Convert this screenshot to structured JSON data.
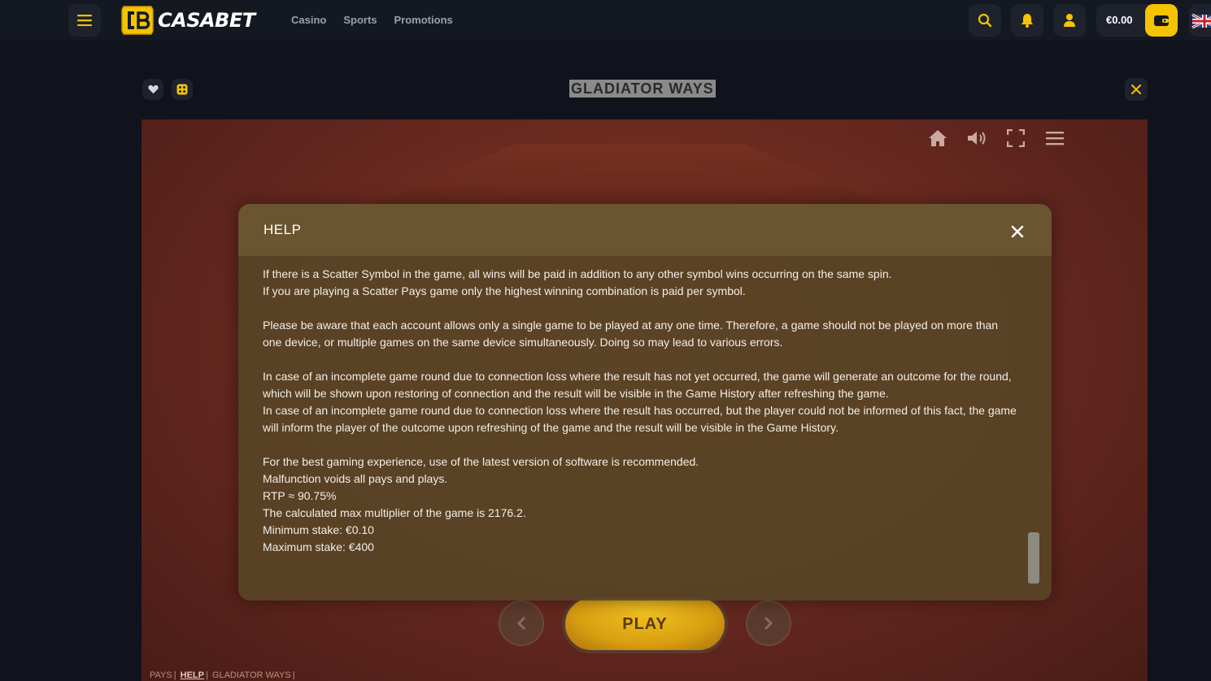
{
  "header": {
    "logo_text": "CASABET",
    "nav": [
      "Casino",
      "Sports",
      "Promotions"
    ],
    "balance": "€0.00"
  },
  "game": {
    "title": "GLADIATOR WAYS",
    "play_label": "PLAY",
    "footer_links": [
      "PAYS",
      "HELP",
      "GLADIATOR WAYS"
    ]
  },
  "help": {
    "title": "HELP",
    "paragraphs": [
      [
        "If there is a Scatter Symbol in the game, all wins will be paid in addition to any other symbol wins occurring on the same spin.",
        "If you are playing a Scatter Pays game only the highest winning combination is paid per symbol."
      ],
      [
        "Please be aware that each account allows only a single game to be played at any one time. Therefore, a game should not be played on more than one device, or multiple games on the same device simultaneously. Doing so may lead to various errors."
      ],
      [
        "In case of an incomplete game round due to connection loss where the result has not yet occurred, the game will generate an outcome for the round, which will be shown upon restoring of connection and the result will be visible in the Game History after refreshing the game.",
        "In case of an incomplete game round due to connection loss where the result has occurred, but the player could not be informed of this fact, the game will inform the player of the outcome upon refreshing of the game and the result will be visible in the Game History."
      ],
      [
        "For the best gaming experience, use of the latest version of software is recommended.",
        "Malfunction voids all pays and plays.",
        "RTP ≈ 90.75%",
        "The calculated max multiplier of the game is 2176.2.",
        "Minimum stake: €0.10",
        "Maximum stake: €400"
      ]
    ]
  },
  "colors": {
    "accent": "#f5c400",
    "topbar": "#141821",
    "modal_header": "#6b5530"
  }
}
